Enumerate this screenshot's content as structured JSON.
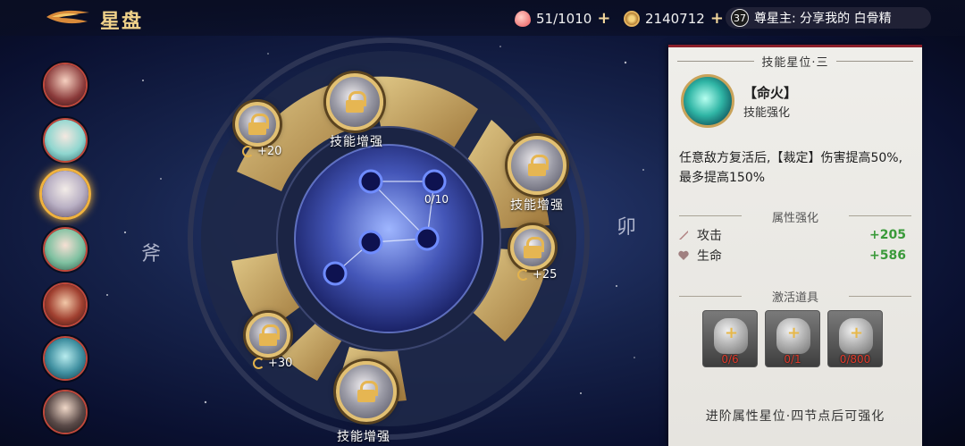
{
  "header": {
    "title": "星盘",
    "stamina": "51/1010",
    "coins": "2140712",
    "master_level": "37",
    "master_text": "尊星主: 分享我的 白骨精"
  },
  "icons": {
    "back": "golden-wing-logo-icon",
    "stamina": "peach-icon",
    "coins": "copper-coin-icon",
    "add": "plus-icon",
    "bonus": "swirl-icon",
    "lock": "lock-icon",
    "attack": "sword-icon",
    "life": "heart-icon"
  },
  "avatars": [
    {
      "name": "character-1",
      "selected": false
    },
    {
      "name": "character-2",
      "selected": false
    },
    {
      "name": "character-3",
      "selected": true
    },
    {
      "name": "character-4",
      "selected": false
    },
    {
      "name": "character-5",
      "selected": false
    },
    {
      "name": "character-6",
      "selected": false
    },
    {
      "name": "character-7",
      "selected": false
    }
  ],
  "dial": {
    "nodes": [
      {
        "label": "技能增强"
      },
      {
        "label": "技能增强"
      },
      {
        "label": "技能增强"
      }
    ],
    "bonuses": [
      "+20",
      "+25",
      "+30"
    ],
    "progress": "0/10",
    "runes": [
      "斧",
      "卯"
    ]
  },
  "panel": {
    "header": "技能星位·三",
    "skill_name": "【命火】",
    "skill_type": "技能强化",
    "description": "任意敌方复活后,【裁定】伤害提高50%,最多提高150%",
    "attr_header": "属性强化",
    "stats": [
      {
        "label": "攻击",
        "value": "+205"
      },
      {
        "label": "生命",
        "value": "+586"
      }
    ],
    "items_header": "激活道具",
    "items": [
      {
        "count": "0/6"
      },
      {
        "count": "0/1"
      },
      {
        "count": "0/800"
      }
    ],
    "footer": "进阶属性星位·四节点后可强化"
  },
  "colors": {
    "accent_gold": "#e2c072",
    "panel_bg": "#efeeea",
    "panel_border": "#8b1f2a",
    "stat_value": "#3a9a3a",
    "item_count": "#e23a2a"
  }
}
